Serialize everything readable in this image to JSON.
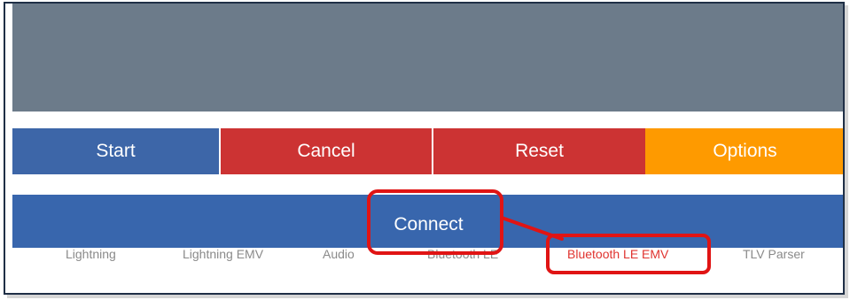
{
  "buttons": {
    "start": "Start",
    "cancel": "Cancel",
    "reset": "Reset",
    "options": "Options"
  },
  "connect": {
    "label": "Connect"
  },
  "tabs": {
    "items": [
      {
        "label": "Lightning"
      },
      {
        "label": "Lightning EMV"
      },
      {
        "label": "Audio"
      },
      {
        "label": "Bluetooth LE"
      },
      {
        "label": "Bluetooth LE EMV"
      },
      {
        "label": "TLV Parser"
      }
    ],
    "selected": "Bluetooth LE EMV"
  },
  "colors": {
    "display_panel": "#6c7b8a",
    "start": "#3d66a8",
    "cancel": "#cc3333",
    "reset": "#cc3333",
    "options": "#fe9a00",
    "connect_bar": "#3866ad",
    "tab_text": "#8a8a8a",
    "tab_active": "#e0332f",
    "annotation": "#e01414"
  }
}
